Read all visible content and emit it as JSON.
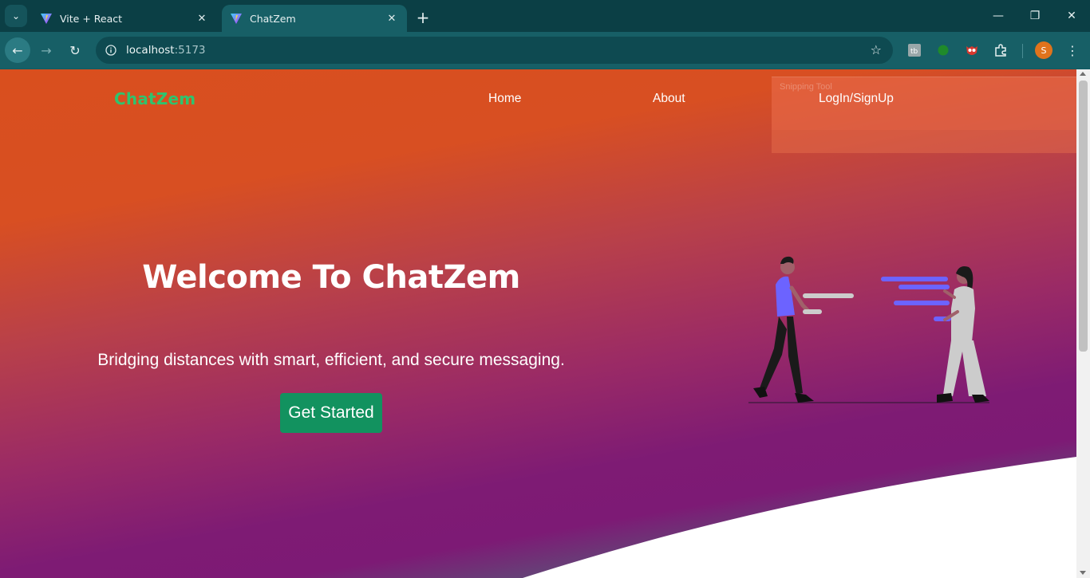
{
  "browser": {
    "tabs": [
      {
        "title": "Vite + React",
        "active": false
      },
      {
        "title": "ChatZem",
        "active": true
      }
    ],
    "address": {
      "host": "localhost",
      "port": ":5173"
    },
    "profile_initial": "S",
    "colors": {
      "frame": "#0b3f45",
      "toolbar": "#175f66",
      "omnibox": "#0e4a51",
      "profile": "#e0731c"
    }
  },
  "page": {
    "brand": "ChatZem",
    "nav": [
      {
        "label": "Home"
      },
      {
        "label": "About"
      },
      {
        "label": "LogIn/SignUp"
      }
    ],
    "overlay_label": "Snipping Tool",
    "hero": {
      "title": "Welcome To ChatZem",
      "subtitle": "Bridging distances with smart, efficient, and secure messaging.",
      "cta_label": "Get Started"
    },
    "colors": {
      "brand": "#2fc36e",
      "cta": "#12925f",
      "gradient_top": "#d94f1e",
      "gradient_mid": "#7d1a75",
      "gradient_bottom": "#2f9e7d"
    }
  }
}
